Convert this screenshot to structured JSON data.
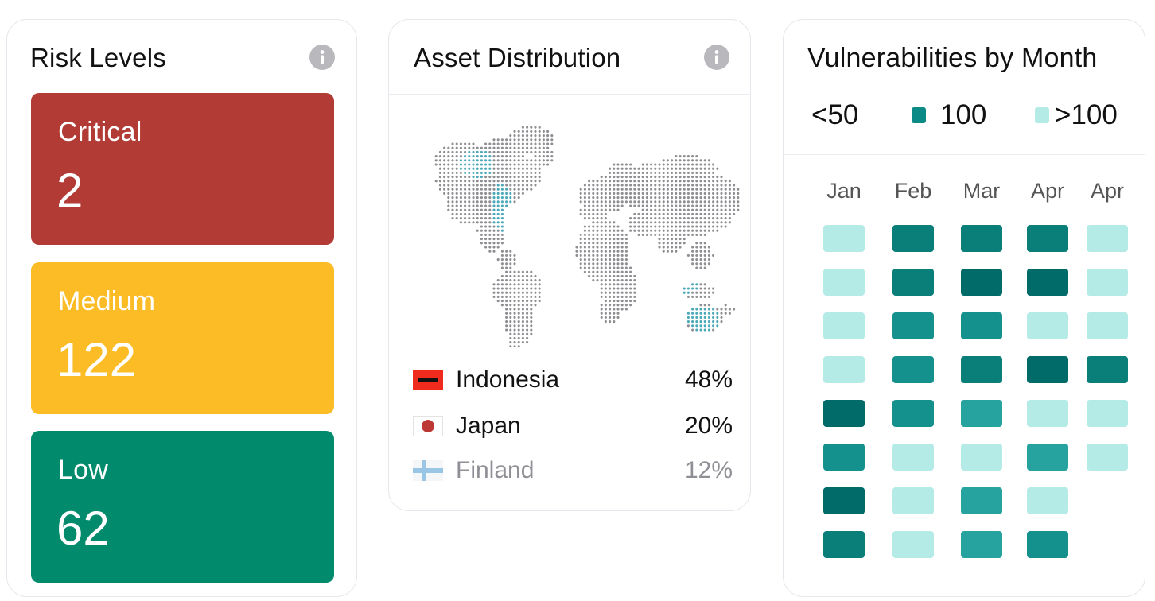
{
  "risk": {
    "title": "Risk Levels",
    "levels": [
      {
        "label": "Critical",
        "value": "2",
        "color": "#b23b35"
      },
      {
        "label": "Medium",
        "value": "122",
        "color": "#fcbc25"
      },
      {
        "label": "Low",
        "value": "62",
        "color": "#028a6d"
      }
    ]
  },
  "asset": {
    "title": "Asset Distribution",
    "countries": [
      {
        "name": "Indonesia",
        "pct": "48%"
      },
      {
        "name": "Japan",
        "pct": "20%"
      },
      {
        "name": "Finland",
        "pct": "12%"
      }
    ]
  },
  "vuln": {
    "title": "Vulnerabilities by Month",
    "legend": [
      "<50",
      "100",
      ">100"
    ],
    "legend_colors": [
      "#ffffff",
      "#0c8a85",
      "#b4ebe6"
    ],
    "months": [
      "Jan",
      "Feb",
      "Mar",
      "Apr",
      "Apr"
    ],
    "level_colors": [
      "#b4ebe6",
      "#26a39e",
      "#14918d",
      "#0a7e79",
      "#006b68"
    ],
    "grid": [
      [
        0,
        3,
        3,
        3,
        0
      ],
      [
        0,
        3,
        4,
        4,
        0
      ],
      [
        0,
        2,
        2,
        0,
        0
      ],
      [
        0,
        2,
        3,
        4,
        3
      ],
      [
        4,
        2,
        1,
        0,
        0
      ],
      [
        2,
        0,
        0,
        1,
        0
      ],
      [
        4,
        0,
        1,
        0,
        null
      ],
      [
        3,
        0,
        1,
        2,
        null
      ]
    ]
  }
}
